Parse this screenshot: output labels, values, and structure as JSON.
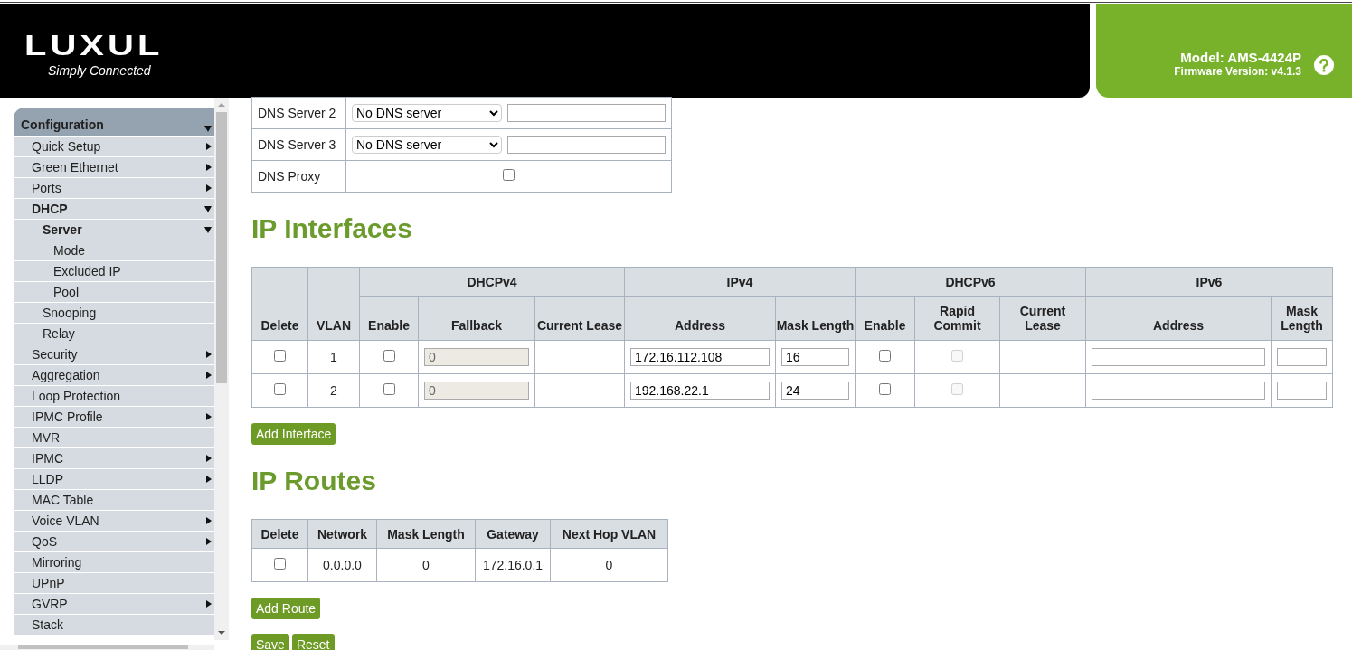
{
  "header": {
    "logo": "LUXUL",
    "tagline": "Simply Connected",
    "model": "Model: AMS-4424P",
    "firmware": "Firmware Version: v4.1.3"
  },
  "sidebar": {
    "items": [
      {
        "label": "Configuration",
        "expanded": true,
        "children": [
          {
            "label": "Quick Setup",
            "expanded": false
          },
          {
            "label": "Green Ethernet",
            "expanded": false
          },
          {
            "label": "Ports",
            "expanded": false
          },
          {
            "label": "DHCP",
            "expanded": true,
            "children": [
              {
                "label": "Server",
                "expanded": true,
                "children": [
                  {
                    "label": "Mode"
                  },
                  {
                    "label": "Excluded IP"
                  },
                  {
                    "label": "Pool"
                  }
                ]
              },
              {
                "label": "Snooping"
              },
              {
                "label": "Relay"
              }
            ]
          },
          {
            "label": "Security",
            "expanded": false
          },
          {
            "label": "Aggregation",
            "expanded": false
          },
          {
            "label": "Loop Protection"
          },
          {
            "label": "IPMC Profile",
            "expanded": false
          },
          {
            "label": "MVR"
          },
          {
            "label": "IPMC",
            "expanded": false
          },
          {
            "label": "LLDP",
            "expanded": false
          },
          {
            "label": "MAC Table"
          },
          {
            "label": "Voice VLAN",
            "expanded": false
          },
          {
            "label": "QoS",
            "expanded": false
          },
          {
            "label": "Mirroring"
          },
          {
            "label": "UPnP"
          },
          {
            "label": "GVRP",
            "expanded": false
          },
          {
            "label": "Stack"
          }
        ]
      }
    ]
  },
  "dns_table": {
    "rows": [
      {
        "label": "DNS Server 2",
        "kind": "select",
        "value": "No DNS server"
      },
      {
        "label": "DNS Server 3",
        "kind": "select",
        "value": "No DNS server"
      },
      {
        "label": "DNS Proxy",
        "kind": "checkbox",
        "checked": false
      }
    ]
  },
  "ip_interfaces": {
    "title": "IP Interfaces",
    "column_groups": [
      {
        "label": "DHCPv4",
        "colspan": 3
      },
      {
        "label": "IPv4",
        "colspan": 2
      },
      {
        "label": "DHCPv6",
        "colspan": 3
      },
      {
        "label": "IPv6",
        "colspan": 2
      }
    ],
    "columns": [
      {
        "label": "Delete"
      },
      {
        "label": "VLAN"
      },
      {
        "label": "Enable"
      },
      {
        "label": "Fallback"
      },
      {
        "label": "Current Lease"
      },
      {
        "label": "Address"
      },
      {
        "label": "Mask Length"
      },
      {
        "label": "Enable"
      },
      {
        "label": "Rapid Commit"
      },
      {
        "label": "Current Lease"
      },
      {
        "label": "Address"
      },
      {
        "label": "Mask Length"
      }
    ],
    "rows": [
      {
        "cells": [
          {
            "kind": "checkbox",
            "checked": false,
            "disabled": false
          },
          {
            "kind": "text",
            "text": "1"
          },
          {
            "kind": "checkbox",
            "checked": false,
            "disabled": false
          },
          {
            "kind": "field",
            "value": "0",
            "disabled": true
          },
          {
            "kind": "blank"
          },
          {
            "kind": "field",
            "value": "172.16.112.108",
            "disabled": false
          },
          {
            "kind": "field",
            "value": "16",
            "disabled": false
          },
          {
            "kind": "checkbox",
            "checked": false,
            "disabled": false
          },
          {
            "kind": "checkbox",
            "checked": false,
            "disabled": true
          },
          {
            "kind": "blank"
          },
          {
            "kind": "field",
            "disabled": false
          },
          {
            "kind": "field",
            "disabled": false
          }
        ]
      },
      {
        "cells": [
          {
            "kind": "checkbox",
            "checked": false,
            "disabled": false
          },
          {
            "kind": "text",
            "text": "2"
          },
          {
            "kind": "checkbox",
            "checked": false,
            "disabled": false
          },
          {
            "kind": "field",
            "value": "0",
            "disabled": true
          },
          {
            "kind": "blank"
          },
          {
            "kind": "field",
            "value": "192.168.22.1",
            "disabled": false
          },
          {
            "kind": "field",
            "value": "24",
            "disabled": false
          },
          {
            "kind": "checkbox",
            "checked": false,
            "disabled": false
          },
          {
            "kind": "checkbox",
            "checked": false,
            "disabled": true
          },
          {
            "kind": "blank"
          },
          {
            "kind": "field",
            "disabled": false
          },
          {
            "kind": "field",
            "disabled": false
          }
        ]
      }
    ],
    "button": "Add Interface"
  },
  "ip_routes": {
    "title": "IP Routes",
    "columns": [
      {
        "label": "Delete"
      },
      {
        "label": "Network"
      },
      {
        "label": "Mask Length"
      },
      {
        "label": "Gateway"
      },
      {
        "label": "Next Hop VLAN"
      }
    ],
    "rows": [
      {
        "cells": [
          {
            "kind": "checkbox",
            "checked": false,
            "disabled": false
          },
          {
            "kind": "text",
            "text": "0.0.0.0"
          },
          {
            "kind": "text",
            "text": "0"
          },
          {
            "kind": "text",
            "text": "172.16.0.1"
          },
          {
            "kind": "text",
            "text": "0"
          }
        ]
      }
    ],
    "button": "Add Route"
  },
  "buttons": [
    "Save",
    "Reset"
  ]
}
